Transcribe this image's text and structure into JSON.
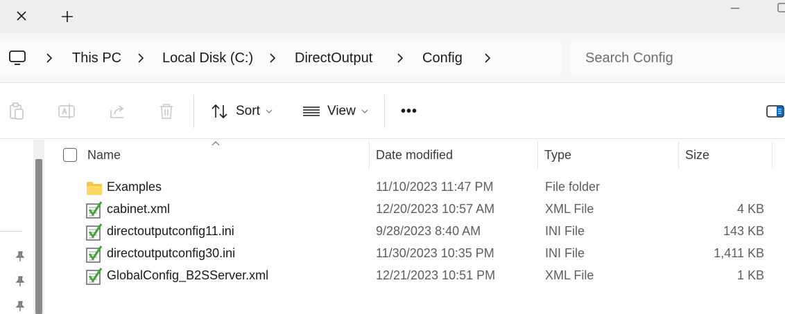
{
  "tabs": {
    "close_glyph": "✕",
    "new_tab_glyph": "+"
  },
  "breadcrumb": [
    "This PC",
    "Local Disk (C:)",
    "DirectOutput",
    "Config"
  ],
  "search": {
    "placeholder": "Search Config",
    "value": ""
  },
  "toolbar": {
    "sort_label": "Sort",
    "view_label": "View",
    "more_label": "•••"
  },
  "columns": {
    "name": "Name",
    "date": "Date modified",
    "type": "Type",
    "size": "Size"
  },
  "files": [
    {
      "name": "Examples",
      "date": "11/10/2023 11:47 PM",
      "type": "File folder",
      "size": "",
      "icon": "folder-icon"
    },
    {
      "name": "cabinet.xml",
      "date": "12/20/2023 10:57 AM",
      "type": "XML File",
      "size": "4 KB",
      "icon": "notepadpp-file-icon"
    },
    {
      "name": "directoutputconfig11.ini",
      "date": "9/28/2023 8:40 AM",
      "type": "INI File",
      "size": "143 KB",
      "icon": "notepadpp-file-icon"
    },
    {
      "name": "directoutputconfig30.ini",
      "date": "11/30/2023 10:35 PM",
      "type": "INI File",
      "size": "1,411 KB",
      "icon": "notepadpp-file-icon"
    },
    {
      "name": "GlobalConfig_B2SServer.xml",
      "date": "12/21/2023 10:51 PM",
      "type": "XML File",
      "size": "1 KB",
      "icon": "notepadpp-file-icon"
    }
  ],
  "colors": {
    "accent": "#0067c0",
    "folder": "#f4c542",
    "file_check": "#3aa63a"
  }
}
